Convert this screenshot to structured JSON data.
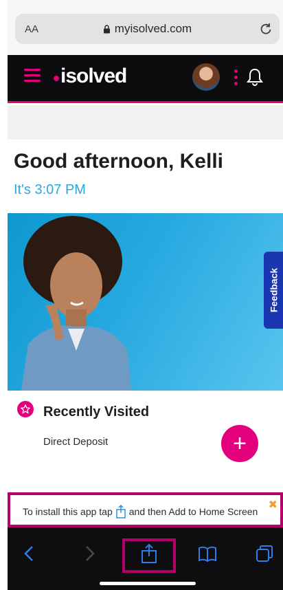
{
  "browser": {
    "text_size_label": "AA",
    "url": "myisolved.com"
  },
  "header": {
    "logo": "isolved"
  },
  "main": {
    "greeting": "Good afternoon, Kelli",
    "time": "It's 3:07 PM"
  },
  "feedback_tab": "Feedback",
  "recently_visited": {
    "title": "Recently Visited",
    "items": [
      "Direct Deposit"
    ]
  },
  "fab_label": "+",
  "install_banner": {
    "text_before": "To install this app tap",
    "text_after": "and then Add to Home Screen",
    "close": "✖"
  },
  "colors": {
    "brand_pink": "#e4007c",
    "accent_blue": "#29a8e0",
    "feedback_blue": "#1a36b0"
  },
  "icons": [
    "lock-icon",
    "reload-icon",
    "hamburger-icon",
    "bell-icon",
    "star-icon",
    "share-icon",
    "back-icon",
    "forward-icon",
    "bookmarks-icon",
    "tabs-icon"
  ]
}
